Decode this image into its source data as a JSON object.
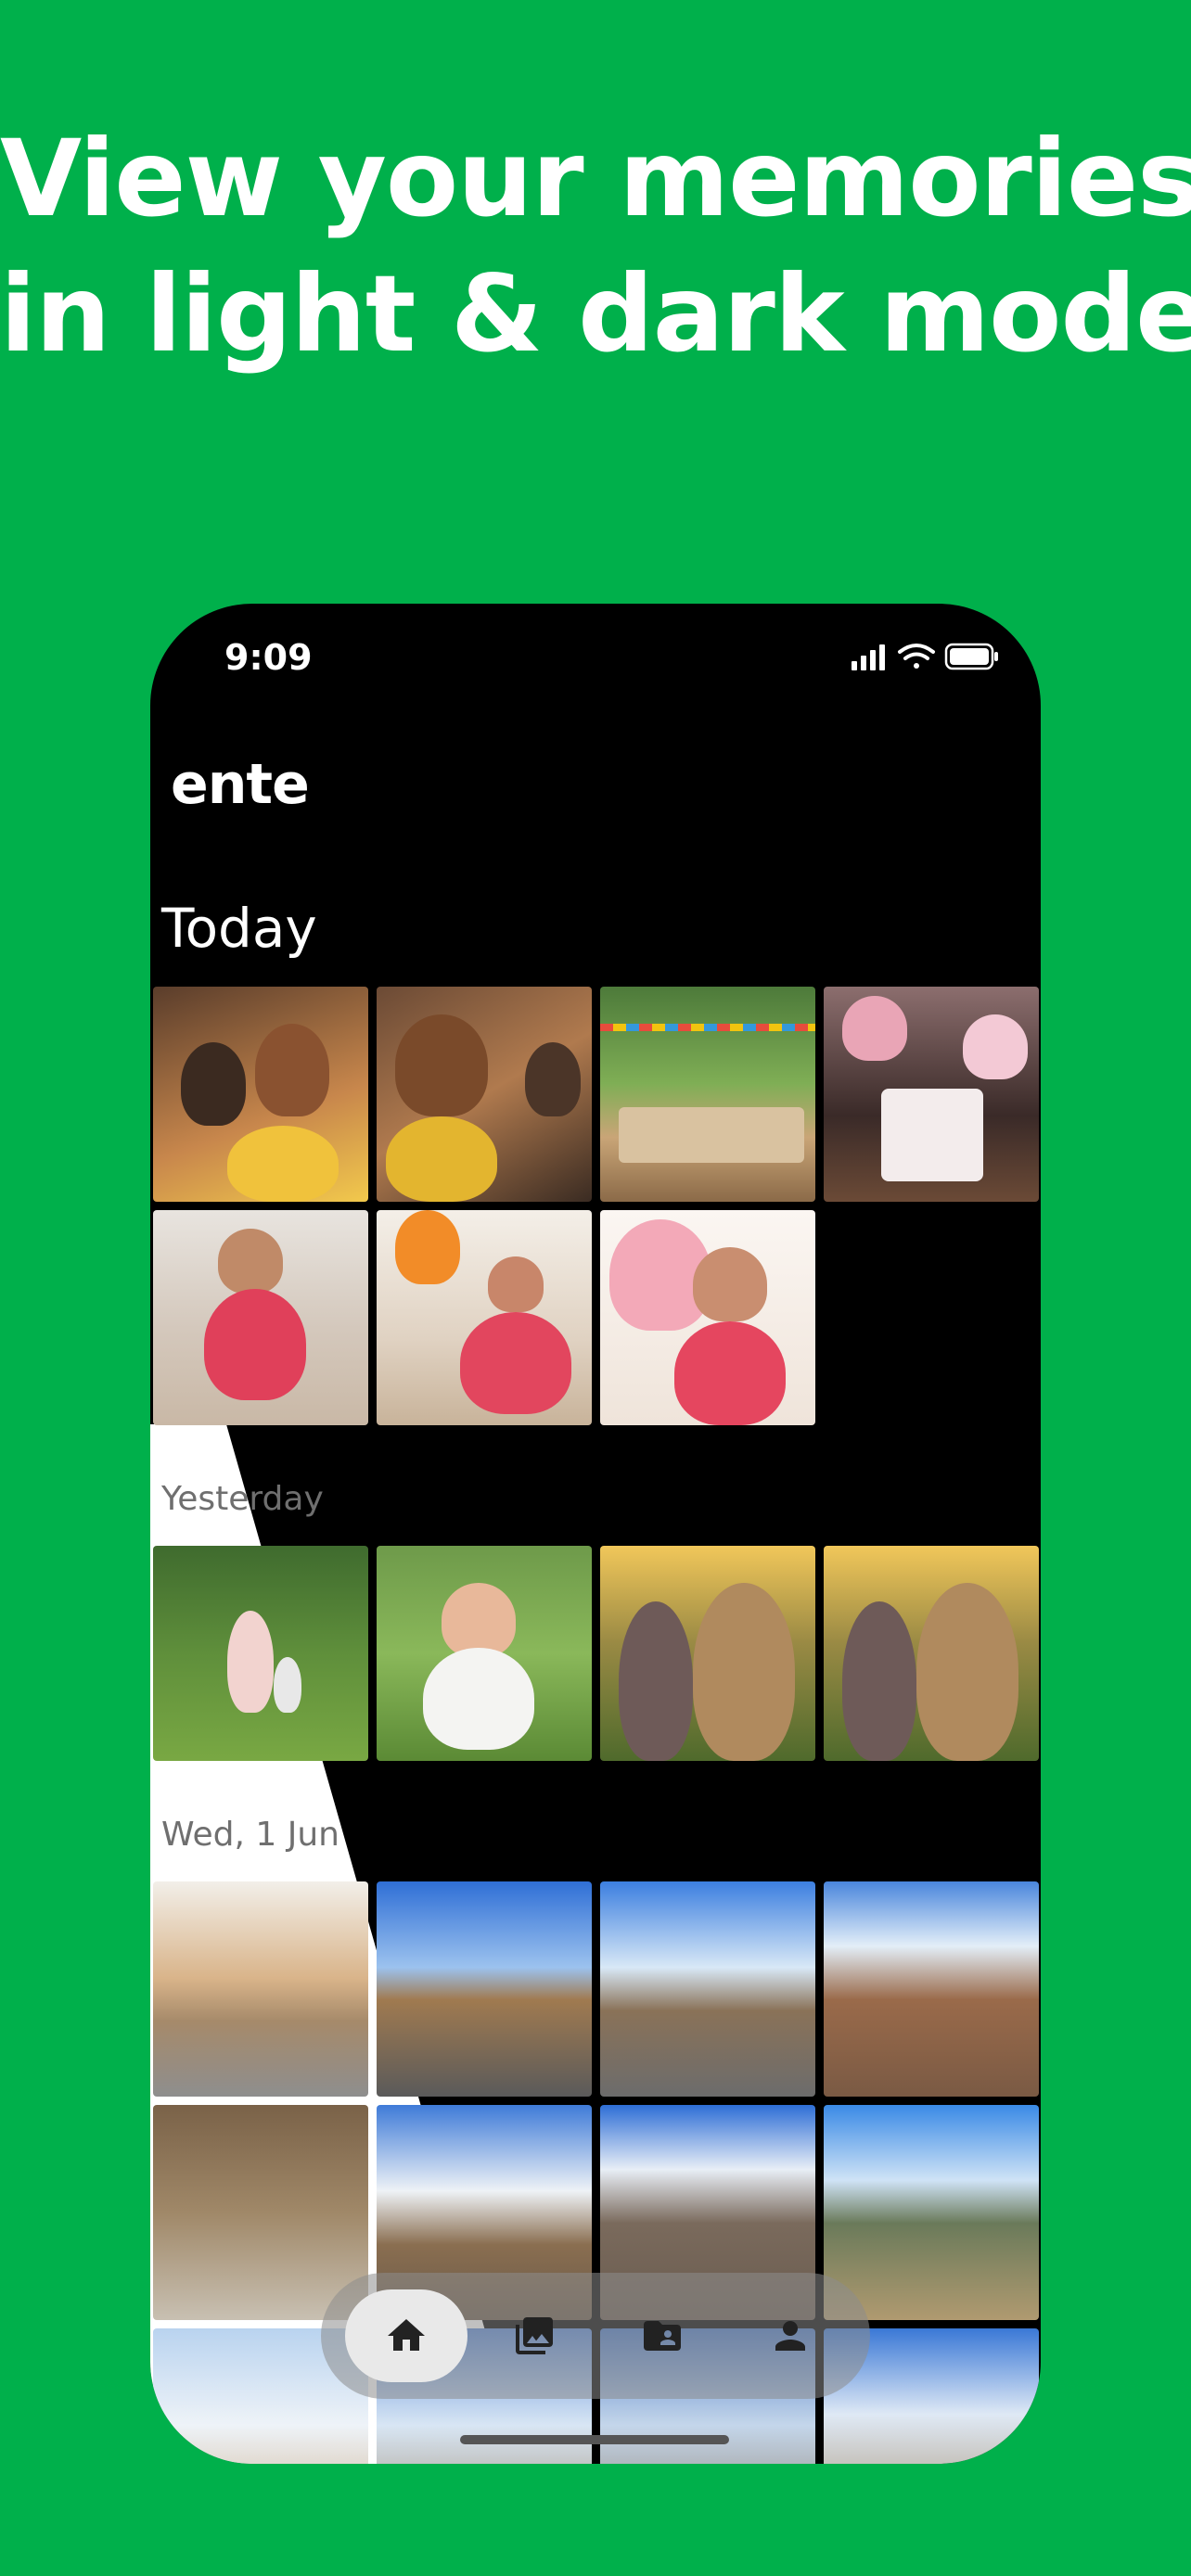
{
  "headline": {
    "line1": "View your memories",
    "line2": "in light & dark mode"
  },
  "phone": {
    "status_time": "9:09",
    "brand": "ente",
    "sections": [
      {
        "title": "Today",
        "photo_count": 7
      },
      {
        "title": "Yesterday",
        "photo_count": 4
      },
      {
        "title": "Wed, 1 Jun",
        "photo_count": 12
      }
    ],
    "tabbar": {
      "items": [
        {
          "icon": "home-icon",
          "active": true
        },
        {
          "icon": "photos-icon",
          "active": false
        },
        {
          "icon": "shared-folder-icon",
          "active": false
        },
        {
          "icon": "account-icon",
          "active": false
        }
      ]
    }
  },
  "colors": {
    "background": "#00B04B",
    "phone_dark": "#000000",
    "light_mode": "#FFFFFF"
  }
}
